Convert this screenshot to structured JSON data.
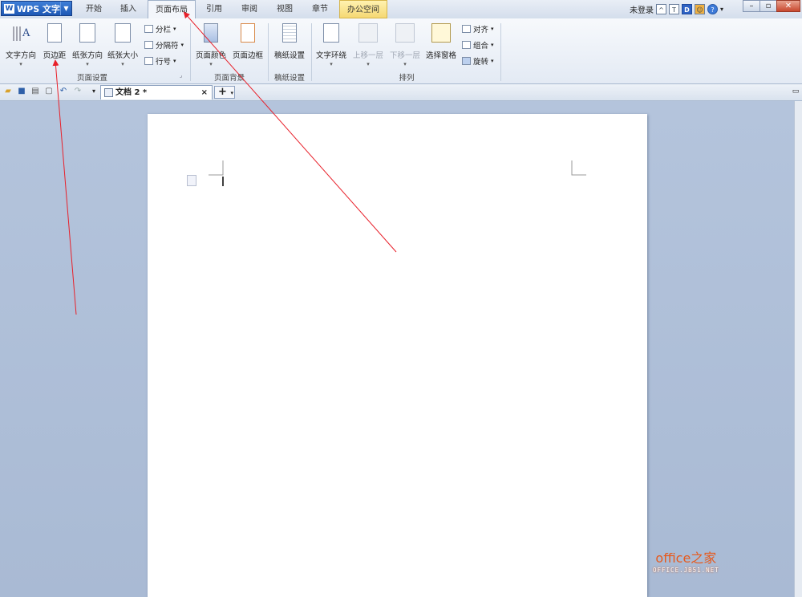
{
  "app": {
    "name": "WPS 文字"
  },
  "tabs": [
    "开始",
    "插入",
    "页面布局",
    "引用",
    "审阅",
    "视图",
    "章节",
    "办公空间"
  ],
  "topright": {
    "login": "未登录"
  },
  "ribbon": {
    "page_setup": {
      "group_label": "页面设置",
      "buttons": {
        "text_direction": "文字方向",
        "margins": "页边距",
        "orientation": "纸张方向",
        "size": "纸张大小"
      },
      "small": {
        "columns": "分栏",
        "breaks": "分隔符",
        "line_numbers": "行号"
      }
    },
    "page_background": {
      "group_label": "页面背景",
      "buttons": {
        "page_color": "页面颜色",
        "page_border": "页面边框"
      }
    },
    "manuscript": {
      "group_label": "稿纸设置",
      "buttons": {
        "manuscript_setup": "稿纸设置"
      }
    },
    "arrange": {
      "group_label": "排列",
      "buttons": {
        "text_wrap": "文字环绕",
        "bring_forward": "上移一层",
        "send_backward": "下移一层",
        "selection_pane": "选择窗格"
      },
      "small": {
        "align": "对齐",
        "group": "组合",
        "rotate": "旋转"
      }
    }
  },
  "document_tab": {
    "title": "文档 2 *",
    "close": "×",
    "new": "+"
  },
  "watermark": {
    "main": "office之家",
    "sub": "OFFICE.JB51.NET"
  },
  "colors": {
    "annotation_arrow": "#e8202a",
    "app_button": "#1e58b4",
    "workspace": "#b4c4dc"
  }
}
